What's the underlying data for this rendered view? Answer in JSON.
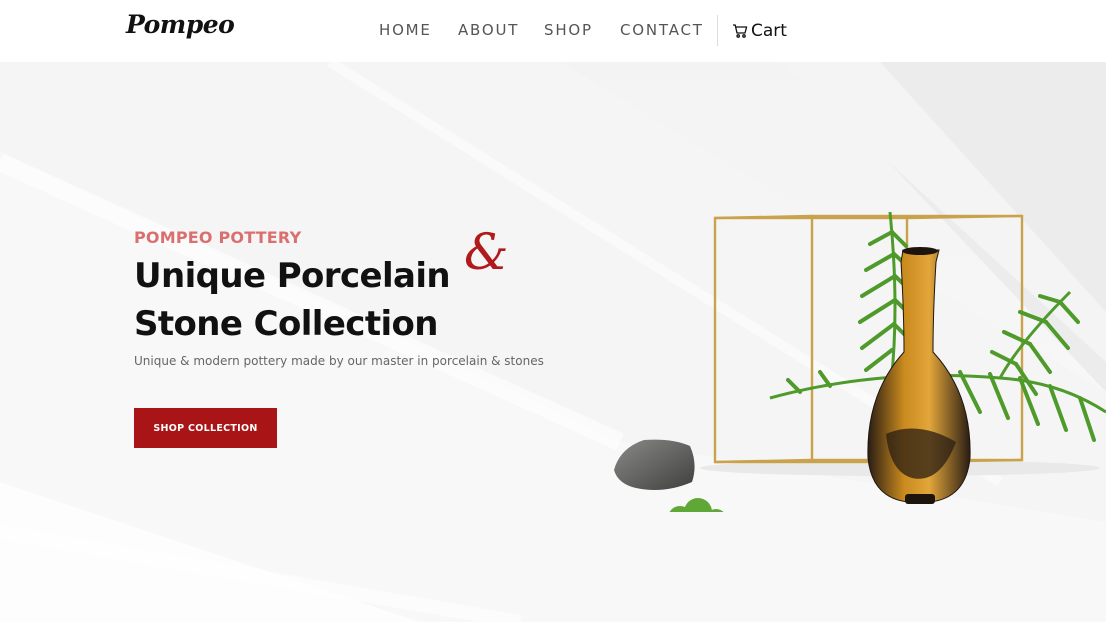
{
  "header": {
    "logo_text": "Pompeo",
    "nav": [
      {
        "label": "HOME"
      },
      {
        "label": "ABOUT"
      },
      {
        "label": "SHOP"
      },
      {
        "label": "CONTACT"
      }
    ],
    "cart_label": "Cart",
    "cart_icon": "shopping-cart-icon"
  },
  "hero": {
    "eyebrow": "POMPEO POTTERY",
    "title": "Unique Porcelain Stone Collection",
    "ampersand": "&",
    "subtitle": "Unique & modern pottery made by our master in porcelain & stones",
    "cta_label": "SHOP COLLECTION"
  },
  "colors": {
    "accent": "#a91416",
    "eyebrow": "#d9706f",
    "ampersand": "#b01a1c",
    "text": "#111111",
    "nav_text": "#555555",
    "vase_gold": "#c98a1e",
    "fern_green": "#4e9a2a",
    "frame_gold": "#c9a24b"
  }
}
